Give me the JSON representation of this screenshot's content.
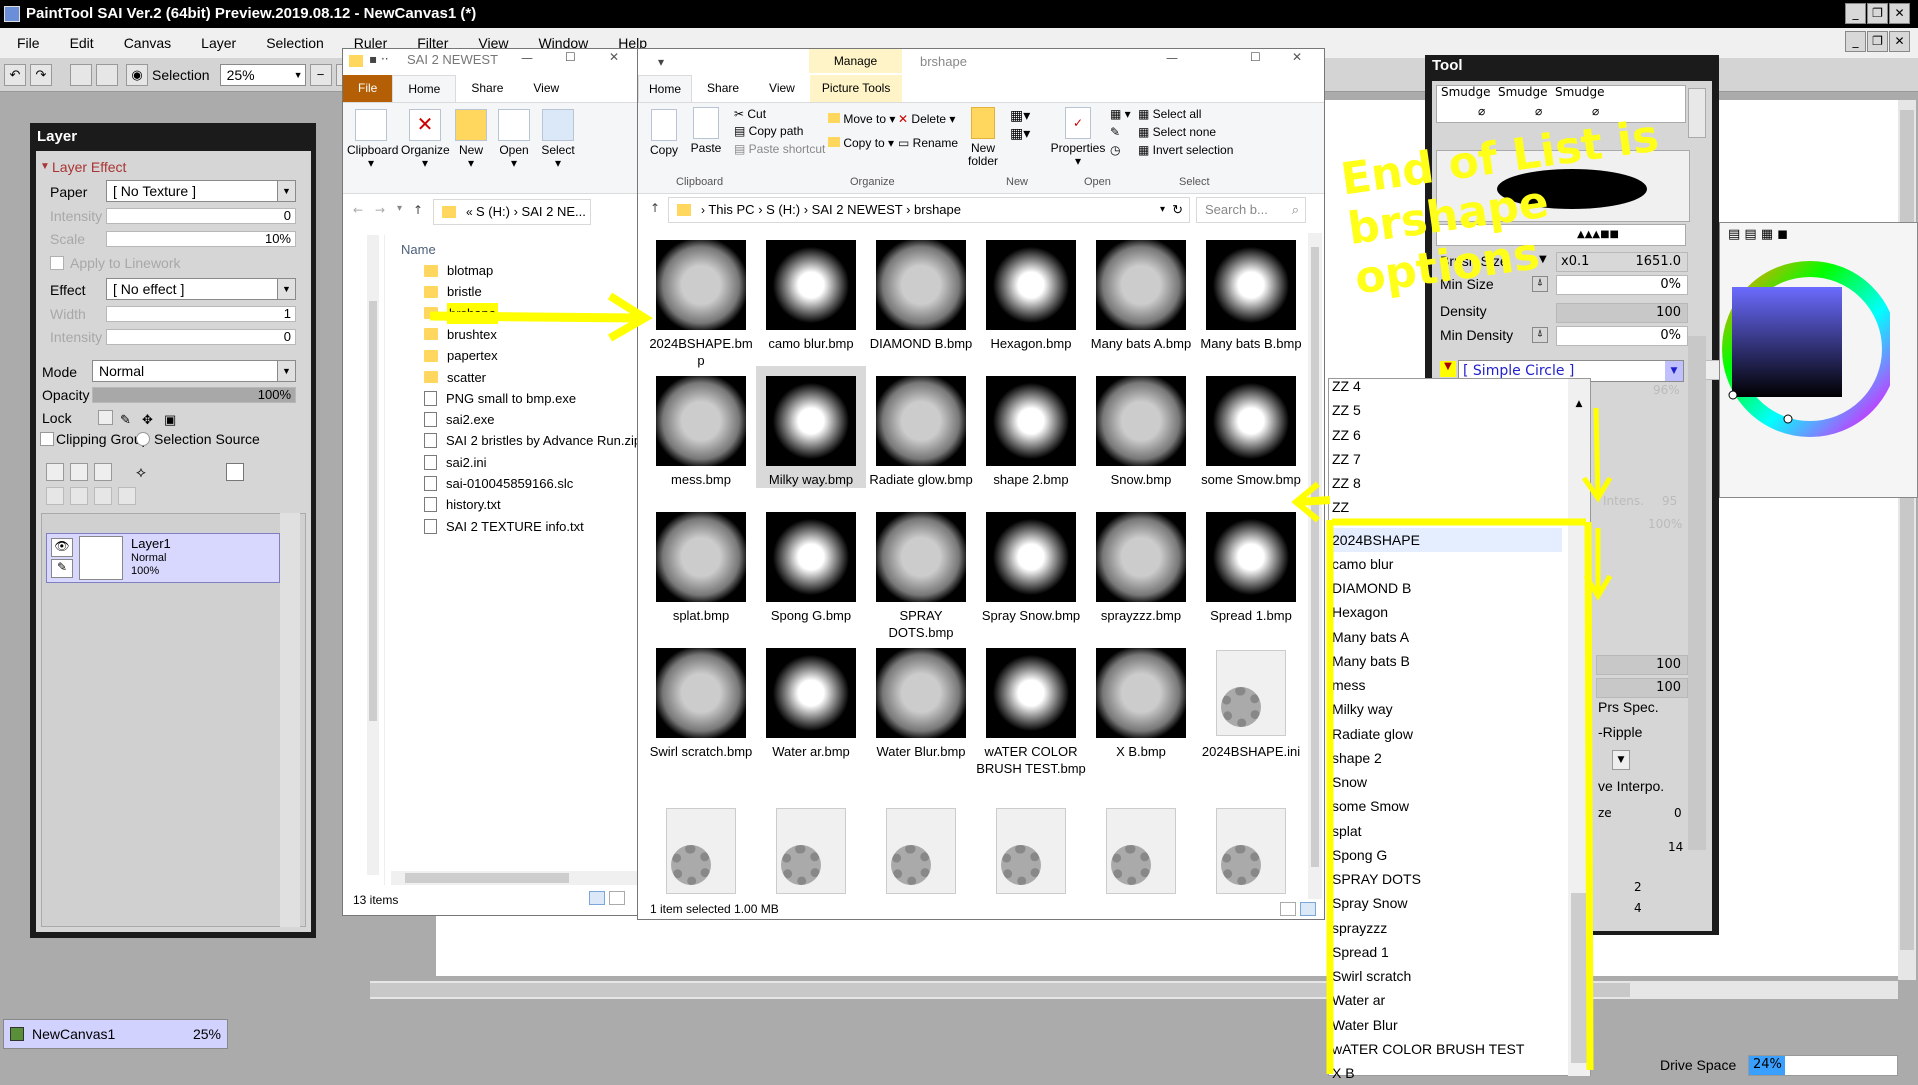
{
  "sai": {
    "title": "PaintTool SAI Ver.2 (64bit) Preview.2019.08.12 - NewCanvas1 (*)",
    "menu": [
      "File",
      "Edit",
      "Canvas",
      "Layer",
      "Selection",
      "Ruler",
      "Filter",
      "View",
      "Window",
      "Help"
    ],
    "toolbar": {
      "selection_label": "Selection",
      "zoom": "25%"
    }
  },
  "layer_panel": {
    "title": "Layer",
    "section": "Layer Effect",
    "paper_label": "Paper",
    "paper_value": "[ No Texture ]",
    "intensity_label": "Intensity",
    "intensity_value": "0",
    "scale_label": "Scale",
    "scale_value": "10%",
    "apply_linework": "Apply to Linework",
    "effect_label": "Effect",
    "effect_value": "[ No effect ]",
    "width_label": "Width",
    "width_value": "1",
    "intensity2_label": "Intensity",
    "intensity2_value": "0",
    "mode_label": "Mode",
    "mode_value": "Normal",
    "opacity_label": "Opacity",
    "opacity_value": "100%",
    "opacity_level": 1.0,
    "lock_label": "Lock",
    "clipping_group": "Clipping Group",
    "selection_source": "Selection Source",
    "layer": {
      "name": "Layer1",
      "mode": "Normal",
      "opacity": "100%"
    }
  },
  "navigator": {
    "canvas_name": "NewCanvas1",
    "zoom": "25%"
  },
  "explorer_left": {
    "title": "SAI 2 NEWEST",
    "tabs": [
      "File",
      "Home",
      "Share",
      "View"
    ],
    "ribbon": [
      "Clipboard",
      "Organize",
      "New",
      "Open",
      "Select"
    ],
    "address": [
      "S (H:)",
      "SAI 2 NE..."
    ],
    "column": "Name",
    "items": [
      {
        "name": "blotmap",
        "type": "folder"
      },
      {
        "name": "bristle",
        "type": "folder"
      },
      {
        "name": "brshape",
        "type": "folder",
        "selected": true
      },
      {
        "name": "brushtex",
        "type": "folder"
      },
      {
        "name": "papertex",
        "type": "folder"
      },
      {
        "name": "scatter",
        "type": "folder"
      },
      {
        "name": "PNG small to bmp.exe",
        "type": "file"
      },
      {
        "name": "sai2.exe",
        "type": "file"
      },
      {
        "name": "SAI 2 bristles by Advance Run.zip",
        "type": "file"
      },
      {
        "name": "sai2.ini",
        "type": "file"
      },
      {
        "name": "sai-010045859166.slc",
        "type": "file"
      },
      {
        "name": "history.txt",
        "type": "file"
      },
      {
        "name": "SAI 2 TEXTURE info.txt",
        "type": "file"
      }
    ],
    "status": "13 items"
  },
  "explorer_right": {
    "title": "brshape",
    "manage": "Manage",
    "picture_tools": "Picture Tools",
    "tabs": [
      "Home",
      "Share",
      "View"
    ],
    "ribbon": {
      "copy": "Copy",
      "paste": "Paste",
      "cut": "Cut",
      "copy_path": "Copy path",
      "paste_shortcut": "Paste shortcut",
      "move_to": "Move to",
      "copy_to": "Copy to",
      "delete": "Delete",
      "rename": "Rename",
      "new_folder": "New folder",
      "properties": "Properties",
      "select_all": "Select all",
      "select_none": "Select none",
      "invert_selection": "Invert selection",
      "groups": [
        "Clipboard",
        "Organize",
        "New",
        "Open",
        "Select"
      ]
    },
    "address": [
      "This PC",
      "S (H:)",
      "SAI 2 NEWEST",
      "brshape"
    ],
    "search_placeholder": "Search b...",
    "files": [
      "2024BSHAPE.bmp",
      "camo blur.bmp",
      "DIAMOND B.bmp",
      "Hexagon.bmp",
      "Many bats A.bmp",
      "Many bats B.bmp",
      "mess.bmp",
      "Milky way.bmp",
      "Radiate glow.bmp",
      "shape 2.bmp",
      "Snow.bmp",
      "some Smow.bmp",
      "splat.bmp",
      "Spong G.bmp",
      "SPRAY DOTS.bmp",
      "Spray Snow.bmp",
      "sprayzzz.bmp",
      "Spread 1.bmp",
      "Swirl scratch.bmp",
      "Water ar.bmp",
      "Water Blur.bmp",
      "wATER COLOR BRUSH TEST.bmp",
      "X B.bmp",
      "2024BSHAPE.ini"
    ],
    "status": "1 item selected  1.00 MB"
  },
  "tool_panel": {
    "title": "Tool",
    "smudges": [
      "Smudge",
      "Smudge",
      "Smudge"
    ],
    "brush_size_label": "Brush Size",
    "brush_size_mult": "x0.1",
    "brush_size_value": "1651.0",
    "min_size_label": "Min Size",
    "min_size_value": "0%",
    "density_label": "Density",
    "density_value": "100",
    "min_density_label": "Min Density",
    "min_density_value": "0%",
    "shape_value": "[ Simple Circle ]",
    "percent_96": "96%",
    "intens": "Intens.",
    "intens_value": "95",
    "percent_100": "100%",
    "val_100a": "100",
    "val_100b": "100",
    "prs_spec": "Prs Spec.",
    "ripple": "-Ripple",
    "interpo": "ve Interpo.",
    "ze": "ze",
    "ze_value": "0",
    "val_14": "14",
    "val_2": "2",
    "val_4": "4"
  },
  "shape_list": [
    "ZZ 4",
    "ZZ 5",
    "ZZ 6",
    "ZZ 7",
    "ZZ 8",
    "ZZ",
    "2024BSHAPE",
    "camo blur",
    "DIAMOND B",
    "Hexagon",
    "Many bats A",
    "Many bats B",
    "mess",
    "Milky way",
    "Radiate glow",
    "shape 2",
    "Snow",
    "some Smow",
    "splat",
    "Spong G",
    "SPRAY DOTS",
    "Spray Snow",
    "sprayzzz",
    "Spread 1",
    "Swirl scratch",
    "Water ar",
    "Water Blur",
    "wATER COLOR BRUSH TEST",
    "X B"
  ],
  "annotation": "End of List is brshape options",
  "status_bar": {
    "drive_label": "Drive Space",
    "drive_value": "24%",
    "drive_level": 0.24
  },
  "colors": {
    "highlight": "#ffff00",
    "selection_blue": "#cce8ff",
    "layer_selected": "#d8d8ff"
  }
}
